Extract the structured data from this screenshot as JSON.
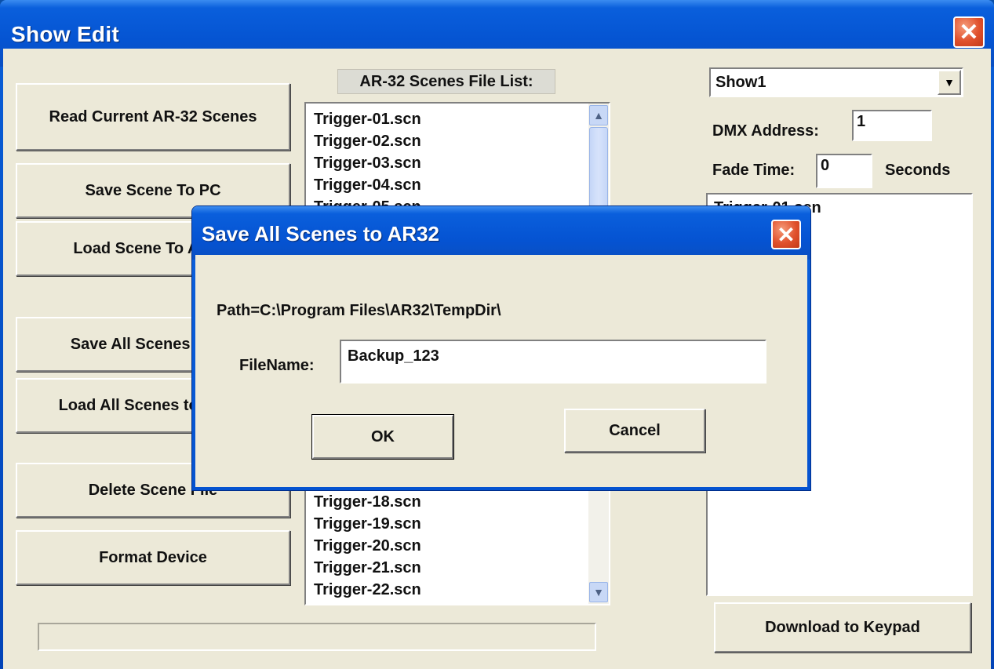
{
  "window": {
    "title": "Show Edit"
  },
  "left_buttons": {
    "read_current": "Read Current AR-32 Scenes",
    "save_scene": "Save Scene To PC",
    "load_scene": "Load Scene To AR-32",
    "save_all": "Save All Scenes to PC",
    "load_all": "Load All Scenes to AR-32",
    "delete_scene": "Delete Scene File",
    "format_device": "Format Device"
  },
  "scene_list": {
    "header": "AR-32 Scenes File List:",
    "items_top": [
      "Trigger-01.scn",
      "Trigger-02.scn",
      "Trigger-03.scn",
      "Trigger-04.scn",
      "Trigger-05.scn"
    ],
    "items_bottom": [
      "Trigger-18.scn",
      "Trigger-19.scn",
      "Trigger-20.scn",
      "Trigger-21.scn",
      "Trigger-22.scn"
    ]
  },
  "show_panel": {
    "show_select": "Show1",
    "dmx_label": "DMX Address:",
    "dmx_value": "1",
    "fade_label": "Fade Time:",
    "fade_value": "0",
    "fade_unit": "Seconds",
    "show_items": [
      "Trigger-01.scn"
    ],
    "download_button": "Download to Keypad"
  },
  "dialog": {
    "title": "Save All Scenes to AR32",
    "path": "Path=C:\\Program Files\\AR32\\TempDir\\",
    "filename_label": "FileName:",
    "filename_value": "Backup_123",
    "ok": "OK",
    "cancel": "Cancel"
  },
  "icons": {
    "close": "close-icon",
    "scroll_up": "scroll-up-icon",
    "scroll_down": "scroll-down-icon",
    "dropdown": "chevron-down-icon"
  }
}
